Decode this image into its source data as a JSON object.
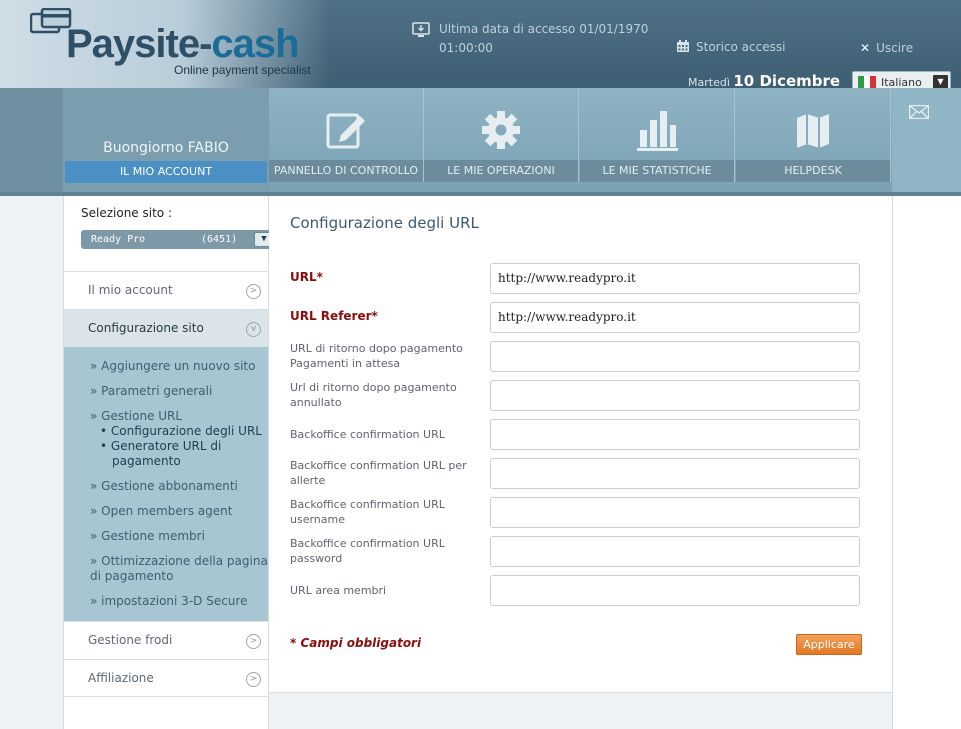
{
  "brand": {
    "logo_main": "Paysite-",
    "logo_accent": "cash",
    "tagline": "Online payment specialist"
  },
  "header": {
    "last_access_line1": "Ultima data di accesso 01/01/1970",
    "last_access_line2": "01:00:00",
    "history_label": "Storico accessi",
    "logout_label": "Uscire",
    "date_prefix": "Martedì",
    "date_main": "10 Dicembre",
    "language": "Italiano"
  },
  "nav": {
    "greeting": "Buongiorno FABIO",
    "my_account": "IL MIO ACCOUNT",
    "tabs": [
      {
        "label": "PANNELLO DI CONTROLLO",
        "icon": "edit-icon"
      },
      {
        "label": "LE MIE OPERAZIONI",
        "icon": "gear-icon"
      },
      {
        "label": "LE MIE STATISTICHE",
        "icon": "bar-chart-icon"
      },
      {
        "label": "HELPDESK",
        "icon": "map-icon"
      }
    ],
    "mail_icon": "mail-icon"
  },
  "sidebar": {
    "site_select_label": "Selezione sito :",
    "site_name": "Ready Pro",
    "site_code": "(6451)",
    "menu": [
      {
        "label": "Il mio account"
      },
      {
        "label": "Configurazione sito"
      },
      {
        "label": "Gestione frodi"
      },
      {
        "label": "Affiliazione"
      }
    ],
    "submenu": [
      "» Aggiungere un nuovo sito",
      "» Parametri generali",
      "» Gestione URL",
      "» Gestione abbonamenti",
      "» Open members agent",
      "» Gestione membri",
      "» Ottimizzazione della pagina",
      "di pagamento",
      "» impostazioni 3-D Secure"
    ],
    "subsubmenu": [
      "• Configurazione degli URL",
      "• Generatore URL di",
      "pagamento"
    ]
  },
  "form": {
    "title": "Configurazione degli URL",
    "fields": [
      {
        "label": "URL*",
        "value": "http://www.readypro.it"
      },
      {
        "label": "URL Referer*",
        "value": "http://www.readypro.it"
      },
      {
        "label": "URL di ritorno dopo pagamento Pagamenti in attesa",
        "value": ""
      },
      {
        "label": "Url di ritorno dopo pagamento annullato",
        "value": ""
      },
      {
        "label": "Backoffice confirmation URL",
        "value": ""
      },
      {
        "label": "Backoffice confirmation URL per allerte",
        "value": ""
      },
      {
        "label": "Backoffice confirmation URL username",
        "value": ""
      },
      {
        "label": "Backoffice confirmation URL password",
        "value": ""
      },
      {
        "label": "URL area membri",
        "value": ""
      }
    ],
    "required_note": "* Campi obbligatori",
    "apply_label": "Applicare"
  }
}
